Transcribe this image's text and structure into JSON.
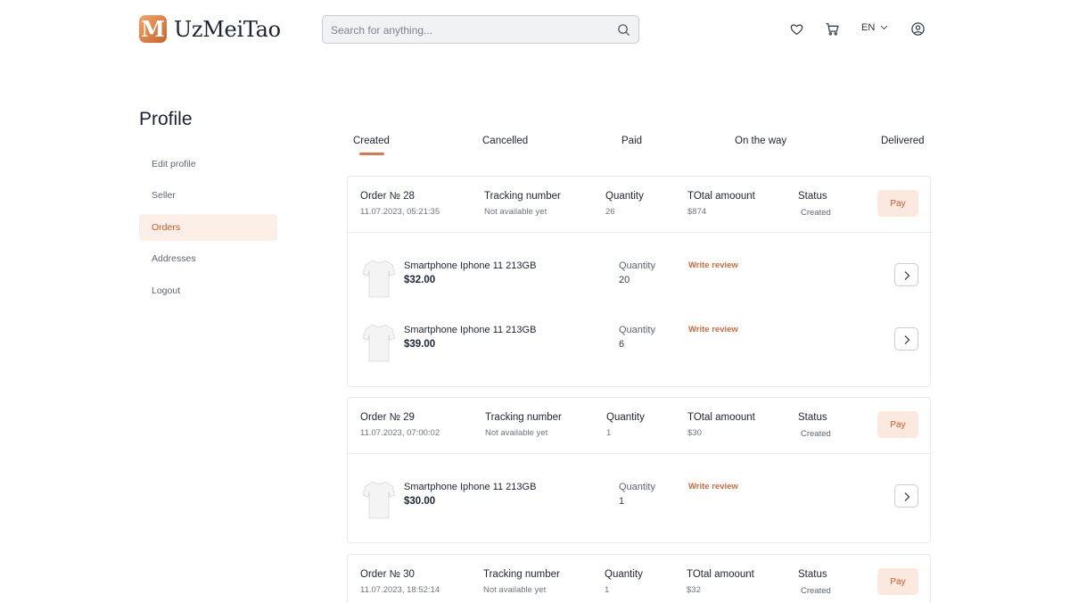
{
  "header": {
    "logo_letter": "M",
    "logo_text": "UzMeiTao",
    "search_placeholder": "Search for anything...",
    "language": "EN",
    "icons": [
      "heart-icon",
      "cart-icon",
      "chevron-down-icon",
      "user-icon",
      "search-icon"
    ]
  },
  "sidebar": {
    "title": "Profile",
    "items": [
      {
        "label": "Edit profile",
        "active": false
      },
      {
        "label": "Seller",
        "active": false
      },
      {
        "label": "Orders",
        "active": true
      },
      {
        "label": "Addresses",
        "active": false
      },
      {
        "label": "Logout",
        "active": false
      }
    ]
  },
  "tabs": [
    {
      "label": "Created",
      "active": true
    },
    {
      "label": "Cancelled",
      "active": false
    },
    {
      "label": "Paid",
      "active": false
    },
    {
      "label": "On the way",
      "active": false
    },
    {
      "label": "Delivered",
      "active": false
    }
  ],
  "labels": {
    "tracking": "Tracking number",
    "quantity": "Quantity",
    "total": "TOtal amoount",
    "status": "Status",
    "pay": "Pay",
    "item_quantity": "Quantity",
    "write_review": "Write review"
  },
  "orders": [
    {
      "title": "Order № 28",
      "date": "11.07.2023, 05:21:35",
      "tracking": "Not available yet",
      "quantity": "26",
      "total": "$874",
      "status": "Created",
      "items": [
        {
          "name": "Smartphone Iphone 11 213GB",
          "price": "$32.00",
          "quantity": "20"
        },
        {
          "name": "Smartphone Iphone 11 213GB",
          "price": "$39.00",
          "quantity": "6"
        }
      ]
    },
    {
      "title": "Order № 29",
      "date": "11.07.2023, 07:00:02",
      "tracking": "Not available yet",
      "quantity": "1",
      "total": "$30",
      "status": "Created",
      "items": [
        {
          "name": "Smartphone Iphone 11 213GB",
          "price": "$30.00",
          "quantity": "1"
        }
      ]
    },
    {
      "title": "Order № 30",
      "date": "11.07.2023, 18:52:14",
      "tracking": "Not available yet",
      "quantity": "1",
      "total": "$32",
      "status": "Created",
      "items": []
    }
  ],
  "colors": {
    "accent": "#c2592a",
    "accent_light": "#fcefe8",
    "pay_bg": "#fbe9df",
    "review": "#cc6b3d"
  }
}
